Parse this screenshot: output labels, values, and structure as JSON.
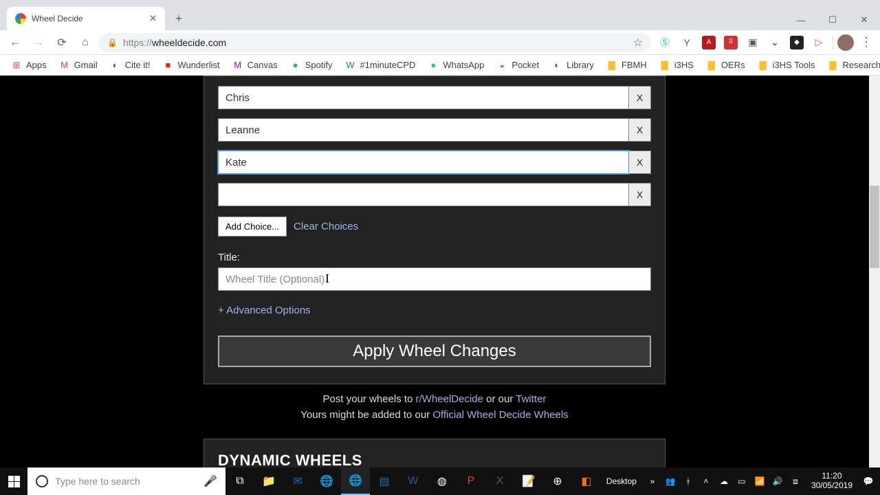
{
  "tab": {
    "title": "Wheel Decide"
  },
  "url": {
    "scheme": "https://",
    "host": "wheeldecide.com"
  },
  "bookmarks": [
    {
      "icon": "⊞",
      "label": "Apps",
      "color": "#ea4335"
    },
    {
      "icon": "M",
      "label": "Gmail",
      "color": "#ea4335"
    },
    {
      "icon": "◐",
      "label": "Cite it!",
      "color": "#555"
    },
    {
      "icon": "■",
      "label": "Wunderlist",
      "color": "#dd2c00"
    },
    {
      "icon": "M",
      "label": "Canvas",
      "color": "#6a1b9a"
    },
    {
      "icon": "●",
      "label": "Spotify",
      "color": "#1db954"
    },
    {
      "icon": "W",
      "label": "#1minuteCPD",
      "color": "#21759b"
    },
    {
      "icon": "●",
      "label": "WhatsApp",
      "color": "#25d366"
    },
    {
      "icon": "◒",
      "label": "Pocket",
      "color": "#ef4056"
    },
    {
      "icon": "◐",
      "label": "Library",
      "color": "#555"
    },
    {
      "icon": "▇",
      "label": "FBMH",
      "color": "#fbc02d"
    },
    {
      "icon": "▇",
      "label": "i3HS",
      "color": "#fbc02d"
    },
    {
      "icon": "▇",
      "label": "OERs",
      "color": "#fbc02d"
    },
    {
      "icon": "▇",
      "label": "i3HS Tools",
      "color": "#fbc02d"
    },
    {
      "icon": "▇",
      "label": "Research",
      "color": "#fbc02d"
    }
  ],
  "choices": [
    {
      "value": "Chris"
    },
    {
      "value": "Leanne"
    },
    {
      "value": "Kate",
      "focused": true
    },
    {
      "value": ""
    }
  ],
  "x_label": "X",
  "add_choice": "Add Choice...",
  "clear_choices": "Clear Choices",
  "title_label": "Title:",
  "title_placeholder": "Wheel Title (Optional)",
  "advanced": "+ Advanced Options",
  "apply": "Apply Wheel Changes",
  "promo": {
    "l1a": "Post your wheels to ",
    "l1link1": "r/WheelDecide",
    "l1b": " or our ",
    "l1link2": "Twitter",
    "l2a": "Yours might be added to our ",
    "l2link": "Official Wheel Decide Wheels"
  },
  "dynamic_heading": "DYNAMIC WHEELS",
  "taskbar": {
    "search_placeholder": "Type here to search",
    "desktop": "Desktop",
    "time": "11:20",
    "date": "30/05/2019"
  }
}
